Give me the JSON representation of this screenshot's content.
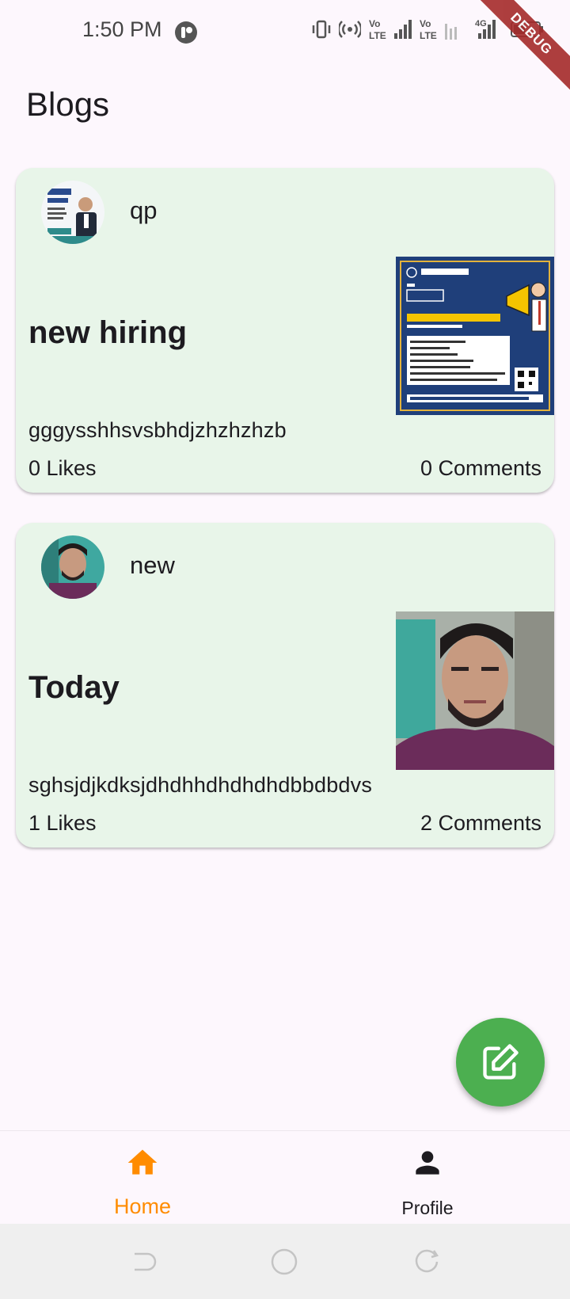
{
  "status_bar": {
    "time": "1:50 PM",
    "debug_label": "DEBUG"
  },
  "header": {
    "title": "Blogs"
  },
  "posts": [
    {
      "author": "qp",
      "title": "new hiring",
      "body": "gggysshhsvsbhdjzhzhzhzb",
      "likes": "0 Likes",
      "comments": "0 Comments",
      "avatar_icon": "hiring-poster-avatar",
      "image_icon": "hiring-poster-image"
    },
    {
      "author": "new",
      "title": "Today",
      "body": "sghsjdjkdksjdhdhhdhdhdhdbbdbdvs",
      "likes": "1 Likes",
      "comments": "2 Comments",
      "avatar_icon": "person-photo-avatar",
      "image_icon": "person-selfie-image"
    }
  ],
  "fab": {
    "icon": "edit-icon",
    "color": "#4caf50"
  },
  "bottom_nav": {
    "items": [
      {
        "label": "Home",
        "icon": "home-icon",
        "active": true,
        "color": "#ff8c00"
      },
      {
        "label": "Profile",
        "icon": "person-icon",
        "active": false,
        "color": "#1d1b20"
      }
    ]
  },
  "colors": {
    "background": "#fdf7fd",
    "card": "#e8f5e9",
    "accent": "#ff8c00",
    "fab": "#4caf50"
  }
}
